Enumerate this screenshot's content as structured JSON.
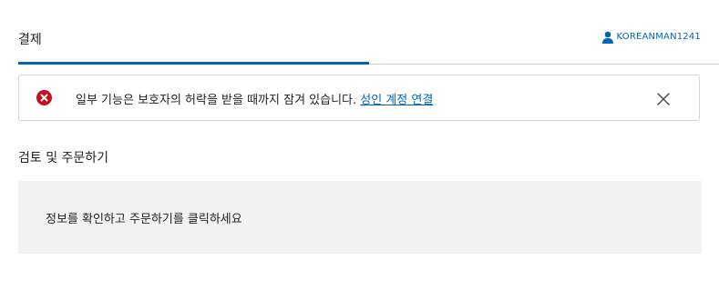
{
  "header": {
    "title": "결제",
    "account_name": "KOREANMAN1241",
    "progress_fraction": 0.5
  },
  "alert": {
    "message": "일부 기능은 보호자의 허락을 받을 때까지 잠겨 있습니다.",
    "link_label": "성인 계정 연결",
    "icon": "error-circle-icon",
    "close_icon": "close-icon"
  },
  "review": {
    "title": "검토 및 주문하기",
    "info_text": "정보를 확인하고 주문하기를 클릭하세요"
  },
  "colors": {
    "accent": "#0067b8",
    "error": "#c50f1f",
    "info_background": "#f2f2f2"
  }
}
